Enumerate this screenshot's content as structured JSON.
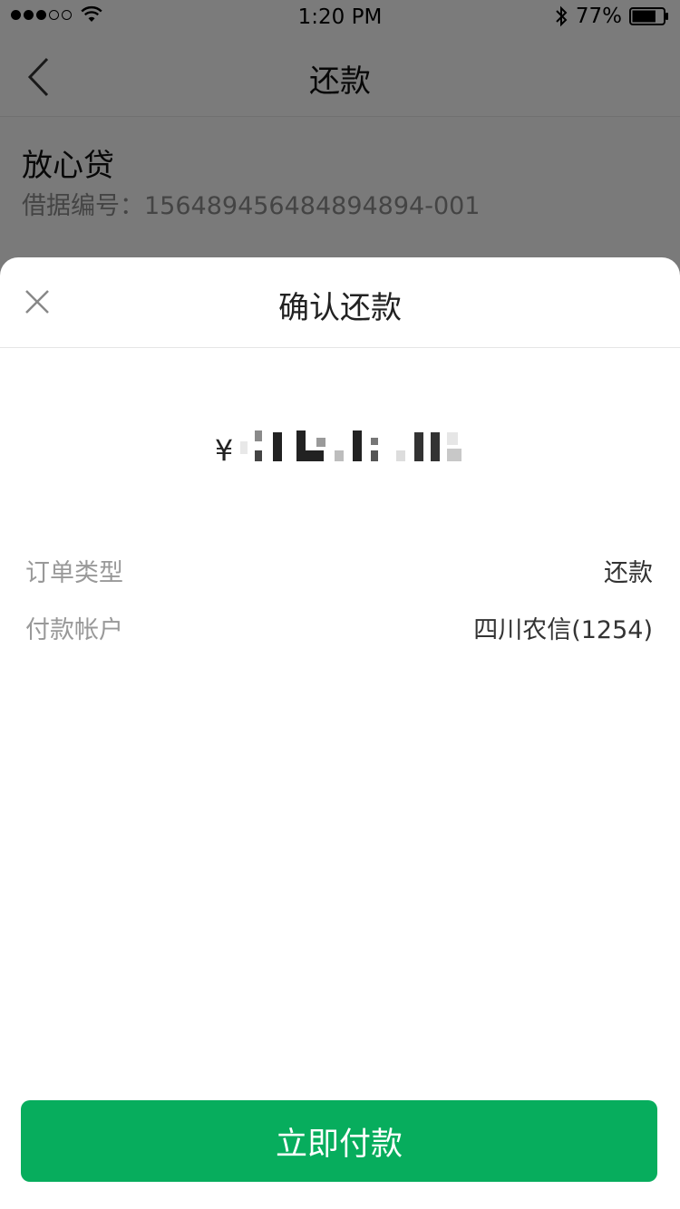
{
  "status_bar": {
    "time": "1:20 PM",
    "battery": "77%",
    "signal_icon": "signal-dots-icon",
    "wifi_icon": "wifi-icon",
    "bluetooth_icon": "bluetooth-icon",
    "battery_level": 0.77
  },
  "nav": {
    "title": "还款",
    "back_icon": "chevron-left-icon"
  },
  "loan": {
    "name": "放心贷",
    "number": "借据编号：156489456484894894-001"
  },
  "sheet": {
    "title": "确认还款",
    "close_icon": "close-icon",
    "currency": "¥",
    "amount": "",
    "details": [
      {
        "label": "订单类型",
        "value": "还款"
      },
      {
        "label": "付款帐户",
        "value": "四川农信(1254)"
      }
    ],
    "pay_label": "立即付款"
  },
  "colors": {
    "accent": "#07ad5d",
    "mask": "rgba(0,0,0,0.5)"
  }
}
